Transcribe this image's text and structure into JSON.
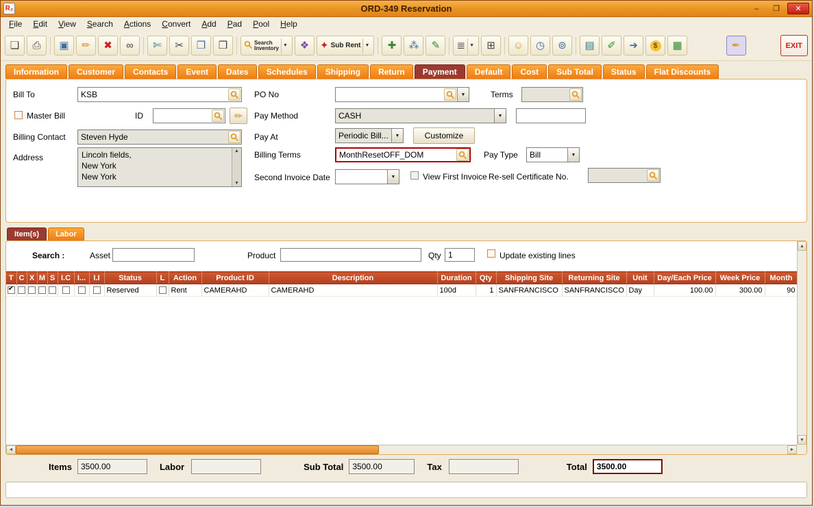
{
  "window": {
    "title": "ORD-349 Reservation",
    "logo": "R₂",
    "minimize": "–",
    "maximize": "❒",
    "close": "✕"
  },
  "menu": [
    "File",
    "Edit",
    "View",
    "Search",
    "Actions",
    "Convert",
    "Add",
    "Pad",
    "Pool",
    "Help"
  ],
  "toolbar": {
    "icons": [
      {
        "name": "new-document",
        "glyph": "❏"
      },
      {
        "name": "print",
        "glyph": "⎙"
      },
      {
        "name": "save",
        "glyph": "▣"
      },
      {
        "name": "edit-pencil",
        "glyph": "✏"
      },
      {
        "name": "delete",
        "glyph": "✖"
      },
      {
        "name": "find-binoculars",
        "glyph": "∞"
      },
      {
        "name": "page-cut",
        "glyph": "✄"
      },
      {
        "name": "cut",
        "glyph": "✂"
      },
      {
        "name": "copy",
        "glyph": "❐"
      },
      {
        "name": "paste",
        "glyph": "❒"
      },
      {
        "name": "prism",
        "glyph": "❖"
      },
      {
        "name": "add",
        "glyph": "✚"
      },
      {
        "name": "group",
        "glyph": "⁂"
      },
      {
        "name": "edit-note",
        "glyph": "✎"
      },
      {
        "name": "stack",
        "glyph": "≣"
      },
      {
        "name": "print-list",
        "glyph": "⊞"
      },
      {
        "name": "smiley",
        "glyph": "☺"
      },
      {
        "name": "history-clock",
        "glyph": "◷"
      },
      {
        "name": "globe",
        "glyph": "⊚"
      },
      {
        "name": "database",
        "glyph": "▤"
      },
      {
        "name": "note-edit",
        "glyph": "✐"
      },
      {
        "name": "key",
        "glyph": "➔"
      },
      {
        "name": "money",
        "glyph": "$"
      },
      {
        "name": "inventory-boxes",
        "glyph": "▦"
      },
      {
        "name": "wand",
        "glyph": "✒"
      }
    ],
    "search_inventory_line1": "Search",
    "search_inventory_line2": "Inventory",
    "sub_rent_glyph": "✦",
    "sub_rent_label": "Sub Rent",
    "exit_label": "EXIT"
  },
  "tabs": [
    "Information",
    "Customer",
    "Contacts",
    "Event",
    "Dates",
    "Schedules",
    "Shipping",
    "Return",
    "Payment",
    "Default",
    "Cost",
    "Sub Total",
    "Status",
    "Flat Discounts"
  ],
  "payment": {
    "bill_to_label": "Bill To",
    "bill_to_value": "KSB",
    "po_no_label": "PO No",
    "po_no_value": "",
    "terms_label": "Terms",
    "terms_value": "",
    "master_bill_label": "Master Bill",
    "id_label": "ID",
    "id_value": "",
    "pay_method_label": "Pay Method",
    "pay_method_value": "CASH",
    "pay_method_extra_value": "",
    "billing_contact_label": "Billing Contact",
    "billing_contact_value": "Steven Hyde",
    "pay_at_label": "Pay At",
    "pay_at_value": "Periodic Bill...",
    "customize_label": "Customize",
    "address_label": "Address",
    "address_value": "Lincoln fields,\nNew York\nNew York",
    "billing_terms_label": "Billing Terms",
    "billing_terms_value": "MonthResetOFF_DOM",
    "pay_type_label": "Pay Type",
    "pay_type_value": "Bill",
    "second_invoice_date_label": "Second Invoice Date",
    "second_invoice_date_value": "",
    "view_first_invoice_label": "View First Invoice",
    "resell_certificate_label": "Re-sell Certificate No.",
    "resell_certificate_value": ""
  },
  "items": {
    "tabs": [
      "Item(s)",
      "Labor"
    ],
    "search_label": "Search :",
    "asset_label": "Asset",
    "asset_value": "",
    "product_label": "Product",
    "product_value": "",
    "qty_label": "Qty",
    "qty_value": "1",
    "update_label": "Update existing lines",
    "table": {
      "headers": [
        "T",
        "C",
        "X",
        "M",
        "S",
        "I.C",
        "I...",
        "I.I",
        "Status",
        "L",
        "Action",
        "Product ID",
        "Description",
        "Duration",
        "Qty",
        "Shipping Site",
        "Returning Site",
        "Unit",
        "Day/Each Price",
        "Week Price",
        "Month"
      ],
      "rows": [
        {
          "status": "Reserved",
          "action": "Rent",
          "product_id": "CAMERAHD",
          "description": "CAMERAHD",
          "duration": "100d",
          "qty": "1",
          "shipping_site": "SANFRANCISCO",
          "returning_site": "SANFRANCISCO",
          "unit": "Day",
          "day_each_price": "100.00",
          "week_price": "300.00",
          "month_price": "90"
        }
      ]
    }
  },
  "totals": {
    "items_label": "Items",
    "items_value": "3500.00",
    "labor_label": "Labor",
    "labor_value": "",
    "subtotal_label": "Sub Total",
    "subtotal_value": "3500.00",
    "tax_label": "Tax",
    "tax_value": "",
    "total_label": "Total",
    "total_value": "3500.00"
  }
}
